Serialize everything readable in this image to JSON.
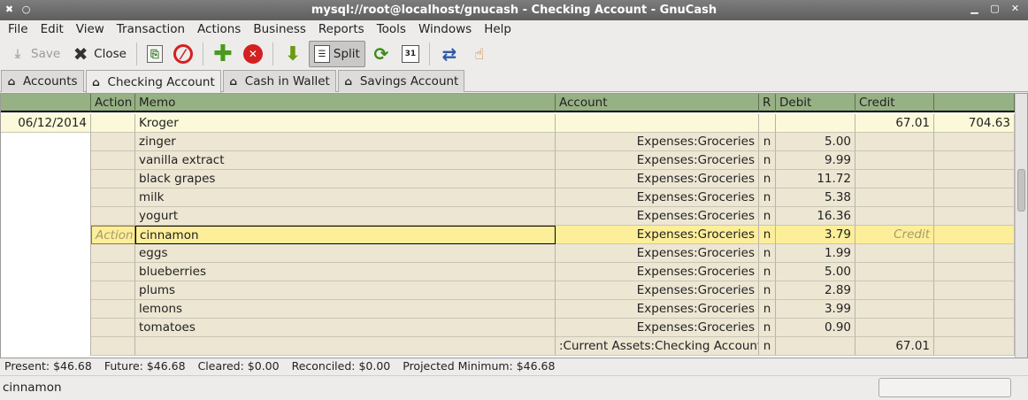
{
  "window": {
    "title": "mysql://root@localhost/gnucash - Checking Account - GnuCash"
  },
  "menu": [
    "File",
    "Edit",
    "View",
    "Transaction",
    "Actions",
    "Business",
    "Reports",
    "Tools",
    "Windows",
    "Help"
  ],
  "toolbar": {
    "save": "Save",
    "close": "Close",
    "split": "Split"
  },
  "tabs": [
    "Accounts",
    "Checking Account",
    "Cash in Wallet",
    "Savings Account"
  ],
  "register": {
    "headers": {
      "action": "Action",
      "memo": "Memo",
      "account": "Account",
      "r": "R",
      "debit": "Debit",
      "credit": "Credit"
    },
    "transaction": {
      "date": "06/12/2014",
      "description": "Kroger",
      "credit": "67.01",
      "balance": "704.63"
    },
    "splits": [
      {
        "memo": "zinger",
        "account": "Expenses:Groceries",
        "r": "n",
        "debit": "5.00",
        "credit": ""
      },
      {
        "memo": "vanilla extract",
        "account": "Expenses:Groceries",
        "r": "n",
        "debit": "9.99",
        "credit": ""
      },
      {
        "memo": "black grapes",
        "account": "Expenses:Groceries",
        "r": "n",
        "debit": "11.72",
        "credit": ""
      },
      {
        "memo": "milk",
        "account": "Expenses:Groceries",
        "r": "n",
        "debit": "5.38",
        "credit": ""
      },
      {
        "memo": "yogurt",
        "account": "Expenses:Groceries",
        "r": "n",
        "debit": "16.36",
        "credit": ""
      },
      {
        "memo": "cinnamon",
        "account": "Expenses:Groceries",
        "r": "n",
        "debit": "3.79",
        "credit": "",
        "action_placeholder": "Action",
        "credit_placeholder": "Credit"
      },
      {
        "memo": "eggs",
        "account": "Expenses:Groceries",
        "r": "n",
        "debit": "1.99",
        "credit": ""
      },
      {
        "memo": "blueberries",
        "account": "Expenses:Groceries",
        "r": "n",
        "debit": "5.00",
        "credit": ""
      },
      {
        "memo": "plums",
        "account": "Expenses:Groceries",
        "r": "n",
        "debit": "2.89",
        "credit": ""
      },
      {
        "memo": "lemons",
        "account": "Expenses:Groceries",
        "r": "n",
        "debit": "3.99",
        "credit": ""
      },
      {
        "memo": "tomatoes",
        "account": "Expenses:Groceries",
        "r": "n",
        "debit": "0.90",
        "credit": ""
      },
      {
        "memo": "",
        "account": ":Current Assets:Checking Account",
        "r": "n",
        "debit": "",
        "credit": "67.01"
      }
    ]
  },
  "summary": {
    "present": "Present: $46.68",
    "future": "Future: $46.68",
    "cleared": "Cleared: $0.00",
    "reconciled": "Reconciled: $0.00",
    "projected": "Projected Minimum: $46.68"
  },
  "status": {
    "text": "cinnamon"
  }
}
